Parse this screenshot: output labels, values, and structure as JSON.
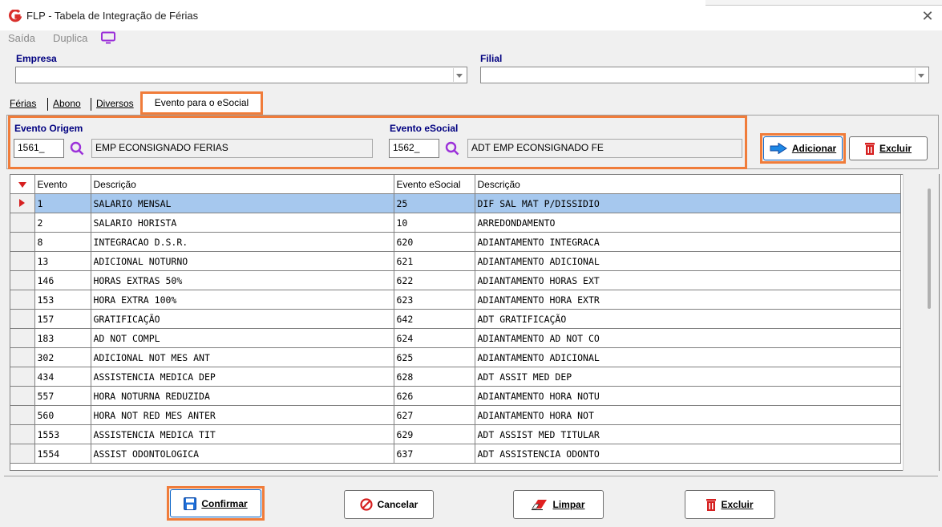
{
  "window": {
    "title": "FLP - Tabela de Integração de Férias",
    "close": "✕"
  },
  "menu": {
    "items": [
      "Saída",
      "Duplica"
    ]
  },
  "empresa": {
    "label": "Empresa",
    "value": ""
  },
  "filial": {
    "label": "Filial",
    "value": ""
  },
  "tabs": [
    {
      "label": "Férias"
    },
    {
      "label": "Abono"
    },
    {
      "label": "Diversos"
    },
    {
      "label": "Evento para o eSocial"
    }
  ],
  "filter": {
    "origem_label": "Evento Origem",
    "origem_code": "1561_",
    "origem_desc": "EMP ECONSIGNADO FERIAS",
    "esocial_label": "Evento eSocial",
    "esocial_code": "1562_",
    "esocial_desc": "ADT EMP ECONSIGNADO FE",
    "add_button": "Adicionar",
    "delete_button": "Excluir"
  },
  "grid": {
    "columns": [
      "Evento",
      "Descrição",
      "Evento eSocial",
      "Descrição"
    ],
    "rows": [
      [
        "1",
        "SALARIO MENSAL",
        "25",
        "DIF SAL MAT P/DISSIDIO"
      ],
      [
        "2",
        "SALARIO HORISTA",
        "10",
        "ARREDONDAMENTO"
      ],
      [
        "8",
        "INTEGRACAO D.S.R.",
        "620",
        "ADIANTAMENTO INTEGRACA"
      ],
      [
        "13",
        "ADICIONAL NOTURNO",
        "621",
        "ADIANTAMENTO ADICIONAL"
      ],
      [
        "146",
        "HORAS EXTRAS 50%",
        "622",
        "ADIANTAMENTO HORAS EXT"
      ],
      [
        "153",
        "HORA EXTRA 100%",
        "623",
        "ADIANTAMENTO HORA EXTR"
      ],
      [
        "157",
        "GRATIFICAÇÃO",
        "642",
        "ADT GRATIFICAÇÃO"
      ],
      [
        "183",
        "AD NOT COMPL",
        "624",
        "ADIANTAMENTO AD NOT CO"
      ],
      [
        "302",
        "ADICIONAL NOT MES ANT",
        "625",
        "ADIANTAMENTO ADICIONAL"
      ],
      [
        "434",
        "ASSISTENCIA MEDICA DEP",
        "628",
        "ADT ASSIT MED DEP"
      ],
      [
        "557",
        "HORA NOTURNA REDUZIDA",
        "626",
        "ADIANTAMENTO HORA NOTU"
      ],
      [
        "560",
        "HORA NOT RED MES ANTER",
        "627",
        "ADIANTAMENTO HORA NOT"
      ],
      [
        "1553",
        "ASSISTENCIA MEDICA TIT",
        "629",
        "ADT ASSIST MED TITULAR"
      ],
      [
        "1554",
        "ASSIST ODONTOLOGICA",
        "637",
        "ADT ASSISTENCIA ODONTO"
      ]
    ]
  },
  "footer": {
    "confirm": "Confirmar",
    "cancel": "Cancelar",
    "clear": "Limpar",
    "delete": "Excluir"
  },
  "colors": {
    "highlight": "#f07c3a",
    "label_blue": "#000080",
    "selected_row": "#a6c8ee",
    "logo_red": "#d9302c"
  },
  "icons": [
    "app-logo-icon",
    "monitor-icon",
    "chevron-down-icon",
    "search-icon",
    "arrow-right-icon",
    "trash-icon",
    "save-icon",
    "cancel-icon",
    "eraser-icon",
    "row-indicator-icon"
  ]
}
